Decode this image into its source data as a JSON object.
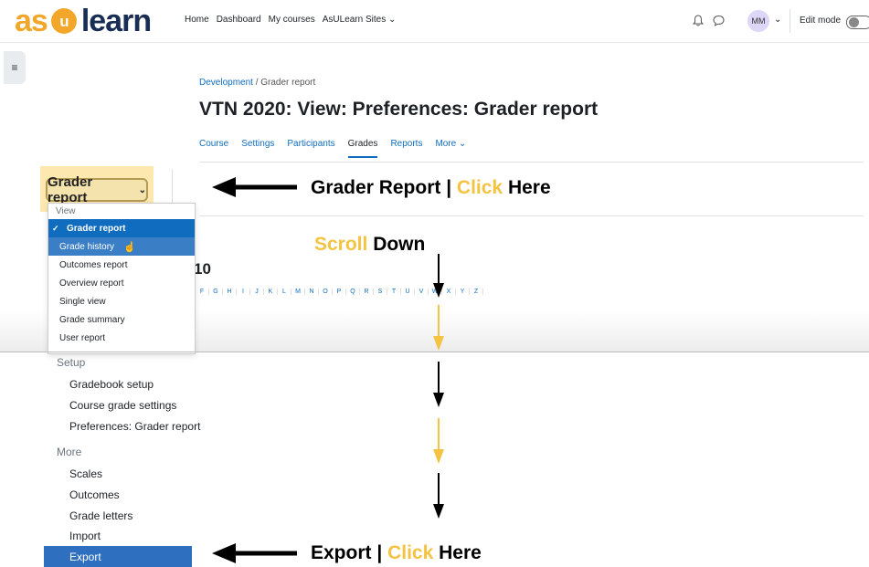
{
  "logo": {
    "left": "as",
    "mid": "u",
    "right": "learn"
  },
  "nav": {
    "items": [
      "Home",
      "Dashboard",
      "My courses",
      "AsULearn Sites ⌄"
    ]
  },
  "navright": {
    "avatar": "MM",
    "avatar_caret": "⌄",
    "edit_mode": "Edit mode"
  },
  "breadcrumb": {
    "link": "Development",
    "sep": "/",
    "current": "Grader report"
  },
  "page_title": "VTN 2020: View: Preferences: Grader report",
  "tabs": [
    "Course",
    "Settings",
    "Participants",
    "Grades",
    "Reports",
    "More ⌄"
  ],
  "report_select": {
    "label": "Grader report",
    "caret": "⌄"
  },
  "menu": {
    "header": "View",
    "items": [
      "Grader report",
      "Grade history",
      "Outcomes report",
      "Overview report",
      "Single view",
      "Grade summary",
      "User report"
    ]
  },
  "partial_heading": "10",
  "letters": [
    "F",
    "G",
    "H",
    "I",
    "J",
    "K",
    "L",
    "M",
    "N",
    "O",
    "P",
    "Q",
    "R",
    "S",
    "T",
    "U",
    "V",
    "W",
    "X",
    "Y",
    "Z"
  ],
  "lower": {
    "setup_header": "Setup",
    "setup_items": [
      "Gradebook setup",
      "Course grade settings",
      "Preferences: Grader report"
    ],
    "more_header": "More",
    "more_items": [
      "Scales",
      "Outcomes",
      "Grade letters",
      "Import",
      "Export"
    ]
  },
  "annotations": {
    "grader_a": "Grader Report | ",
    "grader_b": "Click",
    "grader_c": " Here",
    "scroll_a": "Scroll",
    "scroll_b": " Down",
    "export_a": "Export | ",
    "export_b": "Click",
    "export_c": " Here"
  },
  "colors": {
    "brand_orange": "#f2a72b",
    "brand_navy": "#1a2e55",
    "link_blue": "#0f6cbf",
    "annotation_gold": "#f5c342"
  }
}
